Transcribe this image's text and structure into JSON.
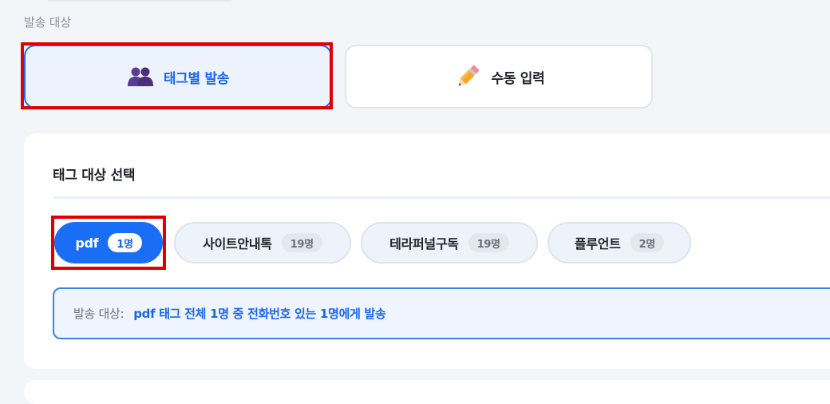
{
  "section": {
    "label": "발송 대상"
  },
  "modes": [
    {
      "id": "tag",
      "label": "태그별 발송",
      "icon": "people-icon",
      "selected": true
    },
    {
      "id": "manual",
      "label": "수동 입력",
      "icon": "pencil-icon",
      "selected": false
    }
  ],
  "tag_card": {
    "title": "태그 대상 선택",
    "tags": [
      {
        "name": "pdf",
        "count": "1명",
        "selected": true
      },
      {
        "name": "사이트안내톡",
        "count": "19명",
        "selected": false
      },
      {
        "name": "테라퍼널구독",
        "count": "19명",
        "selected": false
      },
      {
        "name": "플루언트",
        "count": "2명",
        "selected": false
      }
    ],
    "summary": {
      "label": "발송 대상:",
      "text": "pdf 태그 전체 1명 중 전화번호 있는 1명에게 발송"
    }
  },
  "colors": {
    "accent": "#1a6ef5",
    "highlight": "#e00000",
    "background": "#f3f5f8"
  }
}
